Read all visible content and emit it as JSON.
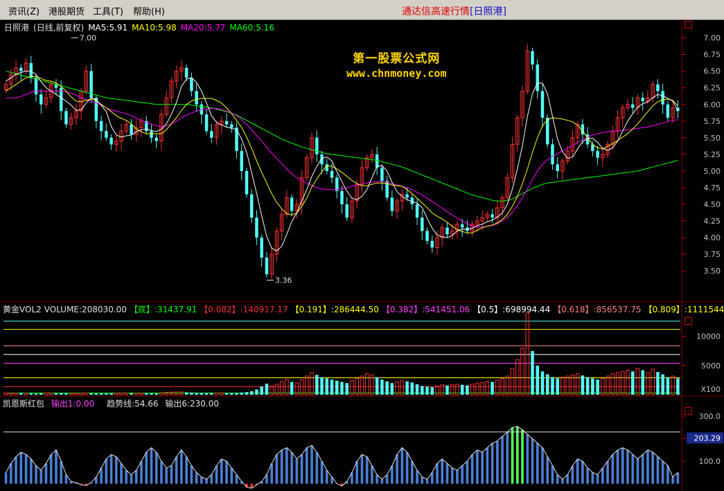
{
  "menu": [
    "资讯(Z)",
    "港股期货",
    "工具(T)",
    "帮助(H)"
  ],
  "app_title": {
    "prefix": "通达信高速行情",
    "stock_mark": "[日照港]"
  },
  "watermark": {
    "site_cn": "第一股票公式网",
    "site_url": "www.chnmoney.com"
  },
  "price_header": {
    "stock": "日照港",
    "mode": "(日线,前复权)",
    "ma": [
      {
        "label": "MA5:5.91",
        "color": "#ffffff"
      },
      {
        "label": "MA10:5.98",
        "color": "#ffff00"
      },
      {
        "label": "MA20:5.77",
        "color": "#ff00ff"
      },
      {
        "label": "MA60:5.16",
        "color": "#00ff00"
      }
    ]
  },
  "volume_header": {
    "title": "黄金VOL2",
    "volume": "VOLUME:208030.00",
    "fib": [
      {
        "label": "【底】",
        "value": ":31437.91",
        "color": "#00ff00"
      },
      {
        "label": "【0.082】",
        "value": ":140917.17",
        "color": "#ff3030"
      },
      {
        "label": "【0.191】",
        "value": ":286444.50",
        "color": "#ffff00"
      },
      {
        "label": "【0.382】",
        "value": ":541451.06",
        "color": "#ff40ff"
      },
      {
        "label": "【0.5】",
        "value": ":698994.44",
        "color": "#ffffff"
      },
      {
        "label": "【0.618】",
        "value": ":856537.75",
        "color": "#ff8080"
      },
      {
        "label": "【0.809】",
        "value": ":1111544.",
        "color": "#ffff00"
      }
    ]
  },
  "indicator_header": {
    "title": "凯恩斯红包",
    "out1": "输出1:0.00",
    "trend": "趋势线:54.66",
    "out6": "输出6:230.00"
  },
  "colors": {
    "up": "#ff3232",
    "down": "#54fcfc",
    "ma5": "#ffffff",
    "ma10": "#ffff00",
    "ma20": "#ff00ff",
    "ma60": "#00ff00",
    "grid": "#800000",
    "hist": "#4a7fd4"
  },
  "chart_data": [
    {
      "type": "candlestick",
      "title": "日照港",
      "ylim": [
        3.2,
        7.1
      ],
      "y_ticks": [
        "7.00",
        "6.75",
        "6.50",
        "6.25",
        "6.00",
        "5.75",
        "5.50",
        "5.25",
        "5.00",
        "4.75",
        "4.50",
        "4.25",
        "4.00",
        "3.75",
        "3.50"
      ],
      "tick_values": [
        7.0,
        6.75,
        6.5,
        6.25,
        6.0,
        5.75,
        5.5,
        5.25,
        5.0,
        4.75,
        4.5,
        4.25,
        4.0,
        3.75,
        3.5
      ],
      "annotations": [
        {
          "text": "7.00",
          "value": 7.0
        },
        {
          "text": "3.36",
          "value": 3.36
        }
      ],
      "close": [
        6.3,
        6.45,
        6.55,
        6.5,
        6.62,
        6.4,
        6.15,
        6.0,
        6.1,
        6.3,
        6.25,
        5.9,
        5.7,
        5.8,
        5.9,
        6.2,
        6.5,
        6.1,
        5.75,
        5.6,
        5.5,
        5.4,
        5.45,
        5.6,
        5.7,
        5.55,
        5.65,
        5.75,
        5.6,
        5.5,
        5.45,
        5.85,
        6.1,
        6.35,
        6.5,
        6.55,
        6.4,
        6.2,
        6.0,
        5.85,
        5.6,
        5.5,
        5.7,
        5.75,
        5.7,
        5.65,
        5.3,
        5.0,
        4.65,
        4.3,
        4.0,
        3.7,
        3.45,
        3.75,
        4.1,
        4.35,
        4.6,
        4.4,
        4.5,
        4.9,
        5.2,
        5.5,
        5.25,
        5.1,
        5.0,
        4.9,
        4.7,
        4.5,
        4.3,
        4.55,
        4.8,
        5.05,
        5.2,
        5.25,
        5.05,
        4.85,
        4.6,
        4.4,
        4.55,
        4.65,
        4.6,
        4.5,
        4.3,
        4.1,
        3.95,
        3.85,
        4.0,
        4.15,
        4.05,
        4.1,
        4.2,
        4.15,
        4.1,
        4.2,
        4.25,
        4.3,
        4.35,
        4.3,
        4.45,
        4.6,
        4.9,
        5.4,
        5.8,
        6.2,
        6.8,
        6.6,
        6.2,
        5.8,
        5.4,
        5.1,
        5.0,
        5.15,
        5.3,
        5.5,
        5.7,
        5.55,
        5.4,
        5.3,
        5.2,
        5.25,
        5.4,
        5.6,
        5.8,
        5.95,
        6.0,
        5.95,
        6.1,
        6.05,
        6.1,
        6.3,
        6.2,
        6.0,
        5.8,
        5.95,
        5.9
      ],
      "ma5": [
        6.35,
        6.4,
        6.45,
        6.48,
        6.5,
        6.5,
        6.45,
        6.34,
        6.25,
        6.2,
        6.15,
        6.1,
        6.05,
        5.99,
        5.91,
        5.92,
        6.02,
        6.1,
        6.07,
        5.99,
        5.89,
        5.67,
        5.54,
        5.51,
        5.53,
        5.54,
        5.59,
        5.62,
        5.63,
        5.61,
        5.59,
        5.63,
        5.71,
        5.85,
        6.03,
        6.27,
        6.38,
        6.4,
        6.33,
        6.2,
        6.02,
        5.83,
        5.73,
        5.69,
        5.66,
        5.64,
        5.62,
        5.48,
        5.28,
        4.98,
        4.66,
        4.33,
        4.02,
        3.84,
        3.8,
        3.87,
        4.05,
        4.24,
        4.37,
        4.55,
        4.72,
        4.92,
        5.07,
        5.19,
        5.21,
        5.15,
        4.99,
        4.84,
        4.7,
        4.59,
        4.57,
        4.62,
        4.72,
        4.9,
        5.07,
        5.08,
        5.0,
        4.83,
        4.69,
        4.62,
        4.57,
        4.54,
        4.52,
        4.45,
        4.29,
        4.14,
        4.04,
        4.01,
        4.0,
        4.03,
        4.1,
        4.13,
        4.12,
        4.14,
        4.18,
        4.2,
        4.24,
        4.26,
        4.31,
        4.37,
        4.5,
        4.73,
        5.03,
        5.38,
        5.82,
        6.16,
        6.32,
        6.32,
        6.16,
        5.82,
        5.48,
        5.29,
        5.19,
        5.21,
        5.33,
        5.44,
        5.49,
        5.49,
        5.43,
        5.34,
        5.31,
        5.35,
        5.45,
        5.6,
        5.75,
        5.86,
        5.96,
        6.01,
        6.04,
        6.1,
        6.15,
        6.13,
        6.09,
        6.05,
        5.91
      ],
      "ma10": [
        6.2,
        6.25,
        6.3,
        6.35,
        6.4,
        6.42,
        6.42,
        6.39,
        6.36,
        6.35,
        6.32,
        6.27,
        6.2,
        6.11,
        6.05,
        6.04,
        6.06,
        6.08,
        6.06,
        6.0,
        5.95,
        5.89,
        5.83,
        5.79,
        5.76,
        5.71,
        5.63,
        5.59,
        5.56,
        5.56,
        5.56,
        5.56,
        5.62,
        5.71,
        5.8,
        5.91,
        6.0,
        6.05,
        6.08,
        6.09,
        6.09,
        6.09,
        6.06,
        6.02,
        5.95,
        5.86,
        5.76,
        5.65,
        5.51,
        5.34,
        5.15,
        4.98,
        4.82,
        4.66,
        4.53,
        4.43,
        4.36,
        4.34,
        4.37,
        4.47,
        4.59,
        4.76,
        4.88,
        4.99,
        5.08,
        5.07,
        5.03,
        4.98,
        4.92,
        4.86,
        4.81,
        4.78,
        4.78,
        4.8,
        4.82,
        4.82,
        4.81,
        4.79,
        4.78,
        4.77,
        4.72,
        4.66,
        4.59,
        4.52,
        4.45,
        4.37,
        4.32,
        4.28,
        4.23,
        4.17,
        4.12,
        4.09,
        4.07,
        4.07,
        4.11,
        4.15,
        4.17,
        4.19,
        4.22,
        4.27,
        4.35,
        4.47,
        4.62,
        4.81,
        5.03,
        5.28,
        5.5,
        5.68,
        5.77,
        5.8,
        5.79,
        5.78,
        5.76,
        5.74,
        5.69,
        5.6,
        5.5,
        5.4,
        5.35,
        5.33,
        5.37,
        5.41,
        5.46,
        5.51,
        5.56,
        5.63,
        5.71,
        5.8,
        5.89,
        5.98,
        6.04,
        6.07,
        6.08,
        6.06,
        5.98
      ],
      "ma20": [
        6.1,
        6.1,
        6.1,
        6.12,
        6.15,
        6.18,
        6.2,
        6.2,
        6.2,
        6.2,
        6.2,
        6.2,
        6.19,
        6.17,
        6.14,
        6.1,
        6.07,
        6.05,
        6.02,
        5.99,
        5.95,
        5.92,
        5.9,
        5.88,
        5.86,
        5.83,
        5.79,
        5.76,
        5.73,
        5.7,
        5.68,
        5.66,
        5.68,
        5.71,
        5.75,
        5.8,
        5.84,
        5.87,
        5.9,
        5.92,
        5.93,
        5.94,
        5.94,
        5.92,
        5.9,
        5.87,
        5.83,
        5.77,
        5.7,
        5.62,
        5.53,
        5.45,
        5.36,
        5.27,
        5.19,
        5.11,
        5.03,
        4.96,
        4.9,
        4.86,
        4.82,
        4.78,
        4.75,
        4.73,
        4.72,
        4.72,
        4.72,
        4.73,
        4.75,
        4.77,
        4.79,
        4.8,
        4.82,
        4.83,
        4.84,
        4.84,
        4.83,
        4.81,
        4.79,
        4.77,
        4.75,
        4.72,
        4.68,
        4.64,
        4.59,
        4.54,
        4.49,
        4.44,
        4.39,
        4.34,
        4.29,
        4.25,
        4.21,
        4.18,
        4.16,
        4.16,
        4.17,
        4.18,
        4.21,
        4.25,
        4.3,
        4.38,
        4.48,
        4.6,
        4.73,
        4.87,
        5.0,
        5.1,
        5.17,
        5.22,
        5.26,
        5.3,
        5.34,
        5.38,
        5.43,
        5.47,
        5.51,
        5.54,
        5.56,
        5.58,
        5.59,
        5.6,
        5.6,
        5.61,
        5.62,
        5.63,
        5.64,
        5.65,
        5.66,
        5.68,
        5.7,
        5.72,
        5.74,
        5.76,
        5.77
      ],
      "ma60": [
        6.5,
        6.48,
        6.46,
        6.44,
        6.42,
        6.4,
        6.38,
        6.36,
        6.34,
        6.32,
        6.3,
        6.28,
        6.26,
        6.24,
        6.22,
        6.2,
        6.18,
        6.16,
        6.14,
        6.12,
        6.1,
        6.09,
        6.08,
        6.07,
        6.06,
        6.05,
        6.04,
        6.03,
        6.02,
        6.01,
        6.0,
        6.0,
        6.0,
        6.0,
        6.0,
        6.0,
        6.0,
        5.99,
        5.98,
        5.97,
        5.96,
        5.95,
        5.93,
        5.91,
        5.89,
        5.87,
        5.84,
        5.8,
        5.76,
        5.72,
        5.68,
        5.64,
        5.6,
        5.56,
        5.52,
        5.48,
        5.45,
        5.42,
        5.39,
        5.36,
        5.34,
        5.32,
        5.3,
        5.28,
        5.26,
        5.25,
        5.24,
        5.23,
        5.22,
        5.21,
        5.2,
        5.19,
        5.18,
        5.17,
        5.16,
        5.14,
        5.12,
        5.1,
        5.08,
        5.06,
        5.03,
        5.0,
        4.97,
        4.94,
        4.91,
        4.88,
        4.85,
        4.82,
        4.79,
        4.76,
        4.73,
        4.7,
        4.67,
        4.64,
        4.62,
        4.6,
        4.58,
        4.56,
        4.55,
        4.55,
        4.56,
        4.58,
        4.62,
        4.66,
        4.7,
        4.74,
        4.77,
        4.8,
        4.82,
        4.83,
        4.84,
        4.85,
        4.86,
        4.87,
        4.88,
        4.89,
        4.9,
        4.91,
        4.92,
        4.93,
        4.94,
        4.95,
        4.96,
        4.97,
        4.98,
        4.99,
        5.0,
        5.02,
        5.04,
        5.06,
        5.08,
        5.1,
        5.12,
        5.14,
        5.16
      ]
    },
    {
      "type": "bar",
      "title": "黄金VOL2",
      "y_ticks": [
        "10000",
        "5000"
      ],
      "tick_values": [
        10000,
        5000
      ],
      "ylim": [
        0,
        14000
      ],
      "unit_label": "X100",
      "values": [
        300,
        250,
        280,
        320,
        260,
        240,
        230,
        260,
        300,
        280,
        270,
        260,
        240,
        230,
        250,
        280,
        300,
        260,
        240,
        230,
        220,
        250,
        270,
        300,
        280,
        260,
        250,
        270,
        290,
        260,
        240,
        350,
        400,
        450,
        500,
        480,
        420,
        380,
        350,
        320,
        300,
        280,
        300,
        320,
        310,
        300,
        330,
        380,
        450,
        600,
        900,
        1400,
        1900,
        1500,
        1800,
        2300,
        2600,
        2200,
        2000,
        2600,
        3200,
        3800,
        3400,
        3000,
        2800,
        2600,
        2400,
        2200,
        2000,
        2400,
        2800,
        3200,
        3600,
        3400,
        3000,
        2600,
        2300,
        2000,
        2200,
        2400,
        2300,
        2100,
        1800,
        1500,
        1400,
        1300,
        1500,
        1700,
        1600,
        1700,
        1800,
        1700,
        1600,
        1800,
        2000,
        2100,
        2300,
        2200,
        2500,
        2800,
        3200,
        4500,
        6000,
        8000,
        14000,
        7500,
        5000,
        4000,
        3500,
        3000,
        2800,
        3000,
        3200,
        3400,
        3600,
        3300,
        3000,
        2800,
        2600,
        2800,
        3200,
        3600,
        3800,
        4000,
        4200,
        4000,
        4500,
        4200,
        3800,
        4400,
        3900,
        3500,
        3000,
        3200,
        2800
      ],
      "fib_levels": [
        {
          "value": 12600,
          "color": "#55ffff"
        },
        {
          "value": 11200,
          "color": "#ffff00"
        },
        {
          "value": 8400,
          "color": "#ff9090"
        },
        {
          "value": 6900,
          "color": "#ffffff"
        },
        {
          "value": 5400,
          "color": "#ff40ff"
        },
        {
          "value": 2900,
          "color": "#ffff00"
        },
        {
          "value": 1400,
          "color": "#ff3030"
        },
        {
          "value": 300,
          "color": "#00ff00"
        }
      ]
    },
    {
      "type": "area",
      "title": "凯恩斯红包",
      "ylim": [
        -20,
        340
      ],
      "y_ticks": [
        "300.0",
        "200.0",
        "100.0"
      ],
      "tick_values": [
        300,
        200,
        100
      ],
      "current_value": "203.29",
      "current_number": 203.29,
      "reference_line": 230,
      "values": [
        50,
        90,
        120,
        140,
        130,
        110,
        80,
        60,
        90,
        130,
        150,
        100,
        40,
        10,
        5,
        -5,
        -8,
        5,
        30,
        70,
        110,
        130,
        120,
        90,
        60,
        40,
        60,
        100,
        140,
        160,
        140,
        100,
        70,
        80,
        120,
        150,
        120,
        80,
        50,
        30,
        20,
        40,
        80,
        110,
        100,
        70,
        40,
        10,
        -15,
        -20,
        -5,
        10,
        40,
        90,
        130,
        150,
        160,
        140,
        110,
        130,
        160,
        170,
        140,
        100,
        60,
        30,
        0,
        -10,
        10,
        50,
        100,
        130,
        120,
        80,
        40,
        20,
        40,
        80,
        130,
        160,
        140,
        100,
        60,
        30,
        20,
        50,
        90,
        110,
        90,
        70,
        60,
        80,
        100,
        130,
        150,
        140,
        160,
        180,
        190,
        210,
        230,
        250,
        255,
        240,
        220,
        200,
        180,
        160,
        120,
        80,
        40,
        20,
        40,
        80,
        110,
        100,
        70,
        50,
        40,
        70,
        100,
        130,
        150,
        160,
        150,
        130,
        110,
        130,
        150,
        140,
        120,
        100,
        80,
        30,
        50
      ]
    }
  ]
}
